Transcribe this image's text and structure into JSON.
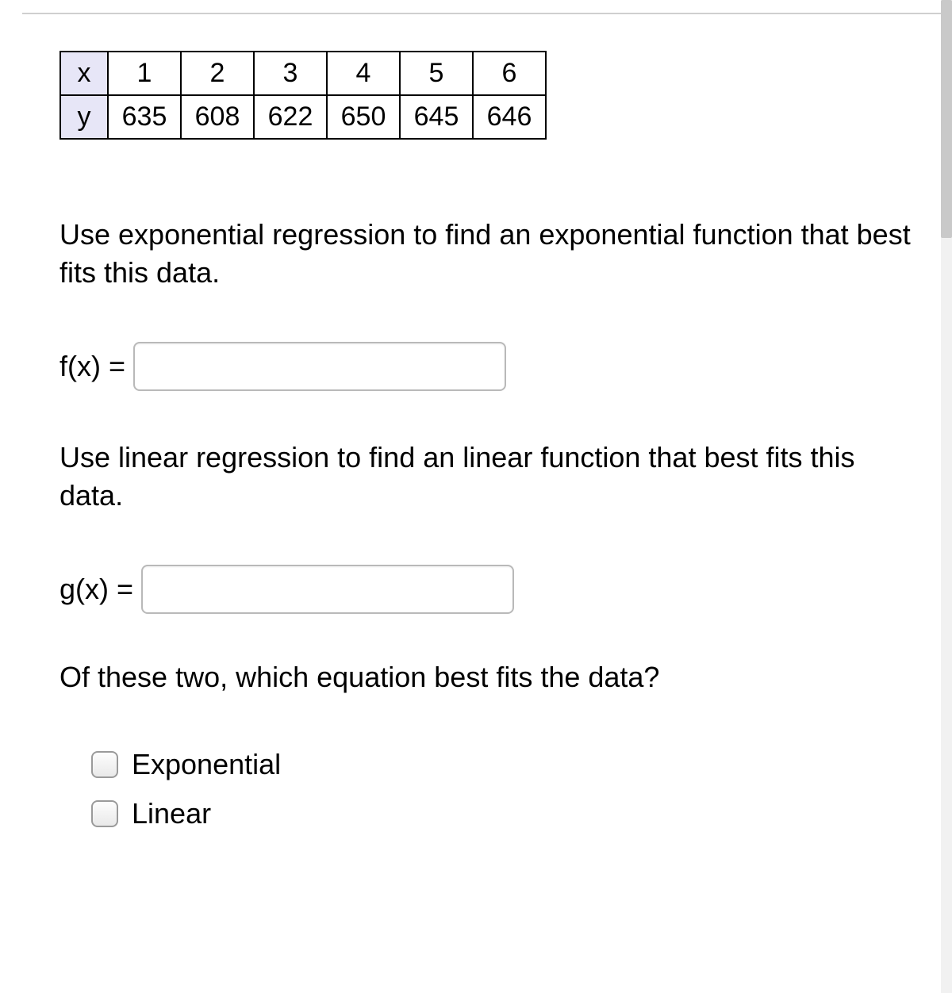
{
  "table": {
    "row_labels": [
      "x",
      "y"
    ],
    "rows": [
      [
        "1",
        "2",
        "3",
        "4",
        "5",
        "6"
      ],
      [
        "635",
        "608",
        "622",
        "650",
        "645",
        "646"
      ]
    ]
  },
  "prompts": {
    "exponential": "Use exponential regression to find an exponential function that best fits this data.",
    "linear": "Use linear regression to find an linear function that best fits this data.",
    "which": "Of these two, which equation best fits the data?"
  },
  "inputs": {
    "fx_label": "f(x) = ",
    "fx_value": "",
    "gx_label": "g(x) = ",
    "gx_value": ""
  },
  "options": {
    "exponential": "Exponential",
    "linear": "Linear"
  },
  "chart_data": {
    "type": "table",
    "columns": [
      "x",
      "y"
    ],
    "rows": [
      [
        1,
        635
      ],
      [
        2,
        608
      ],
      [
        3,
        622
      ],
      [
        4,
        650
      ],
      [
        5,
        645
      ],
      [
        6,
        646
      ]
    ]
  }
}
